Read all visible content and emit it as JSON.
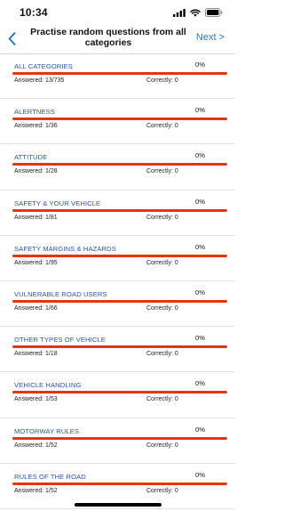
{
  "status_bar": {
    "time": "10:34",
    "icons": [
      "signal-icon",
      "wifi-icon",
      "battery-icon"
    ]
  },
  "nav": {
    "back_icon": "chevron-left-icon",
    "title": "Practise random questions from all categories",
    "next_label": "Next >"
  },
  "colors": {
    "accent": "#2a79d0",
    "label": "#2a55a8",
    "progress_track": "#e53411"
  },
  "categories": [
    {
      "label": "ALL CATEGORIES",
      "percent": "0%",
      "progress": 0,
      "answered": "Answered: 13/735",
      "correct": "Correctly: 0"
    },
    {
      "label": "ALERTNESS",
      "percent": "0%",
      "progress": 0,
      "answered": "Answered: 1/36",
      "correct": "Correctly: 0"
    },
    {
      "label": "ATTITUDE",
      "percent": "0%",
      "progress": 0,
      "answered": "Answered: 1/28",
      "correct": "Correctly: 0"
    },
    {
      "label": "SAFETY & YOUR VEHICLE",
      "percent": "0%",
      "progress": 0,
      "answered": "Answered: 1/81",
      "correct": "Correctly: 0"
    },
    {
      "label": "SAFETY MARGINS & HAZARDS",
      "percent": "0%",
      "progress": 0,
      "answered": "Answered: 1/95",
      "correct": "Correctly: 0"
    },
    {
      "label": "VULNERABLE ROAD USERS",
      "percent": "0%",
      "progress": 0,
      "answered": "Answered: 1/66",
      "correct": "Correctly: 0"
    },
    {
      "label": "OTHER TYPES OF VEHICLE",
      "percent": "0%",
      "progress": 0,
      "answered": "Answered: 1/18",
      "correct": "Correctly: 0"
    },
    {
      "label": "VEHICLE HANDLING",
      "percent": "0%",
      "progress": 0,
      "answered": "Answered: 1/53",
      "correct": "Correctly: 0"
    },
    {
      "label": "MOTORWAY RULES",
      "percent": "0%",
      "progress": 0,
      "answered": "Answered: 1/52",
      "correct": "Correctly: 0"
    },
    {
      "label": "RULES OF THE ROAD",
      "percent": "0%",
      "progress": 0,
      "answered": "Answered: 1/52",
      "correct": "Correctly: 0"
    }
  ]
}
